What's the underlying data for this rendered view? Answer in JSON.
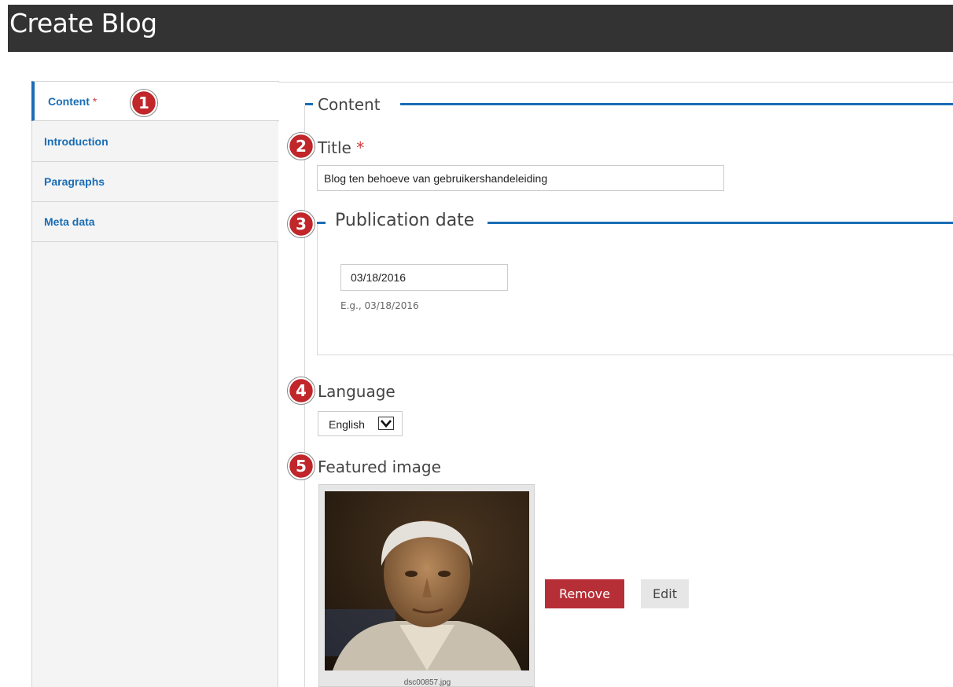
{
  "window": {
    "title": "Create Blog"
  },
  "sidebar": {
    "tabs": [
      {
        "label": "Content",
        "required_mark": "*",
        "active": true
      },
      {
        "label": "Introduction"
      },
      {
        "label": "Paragraphs"
      },
      {
        "label": "Meta data"
      }
    ]
  },
  "content_section": {
    "legend": "Content"
  },
  "title_field": {
    "label": "Title",
    "required_mark": "*",
    "value": "Blog ten behoeve van gebruikershandeleiding"
  },
  "publication_date": {
    "legend": "Publication date",
    "value": "03/18/2016",
    "hint": "E.g., 03/18/2016"
  },
  "language": {
    "label": "Language",
    "selected": "English"
  },
  "featured_image": {
    "label": "Featured image",
    "filename": "dsc00857.jpg",
    "remove_label": "Remove",
    "edit_label": "Edit"
  },
  "annotations": [
    "1",
    "2",
    "3",
    "4",
    "5"
  ],
  "colors": {
    "accent": "#1a6db5",
    "header_bg": "#333333",
    "required": "#d23b3b",
    "remove_button": "#b72f36",
    "badge": "#c0262a"
  }
}
